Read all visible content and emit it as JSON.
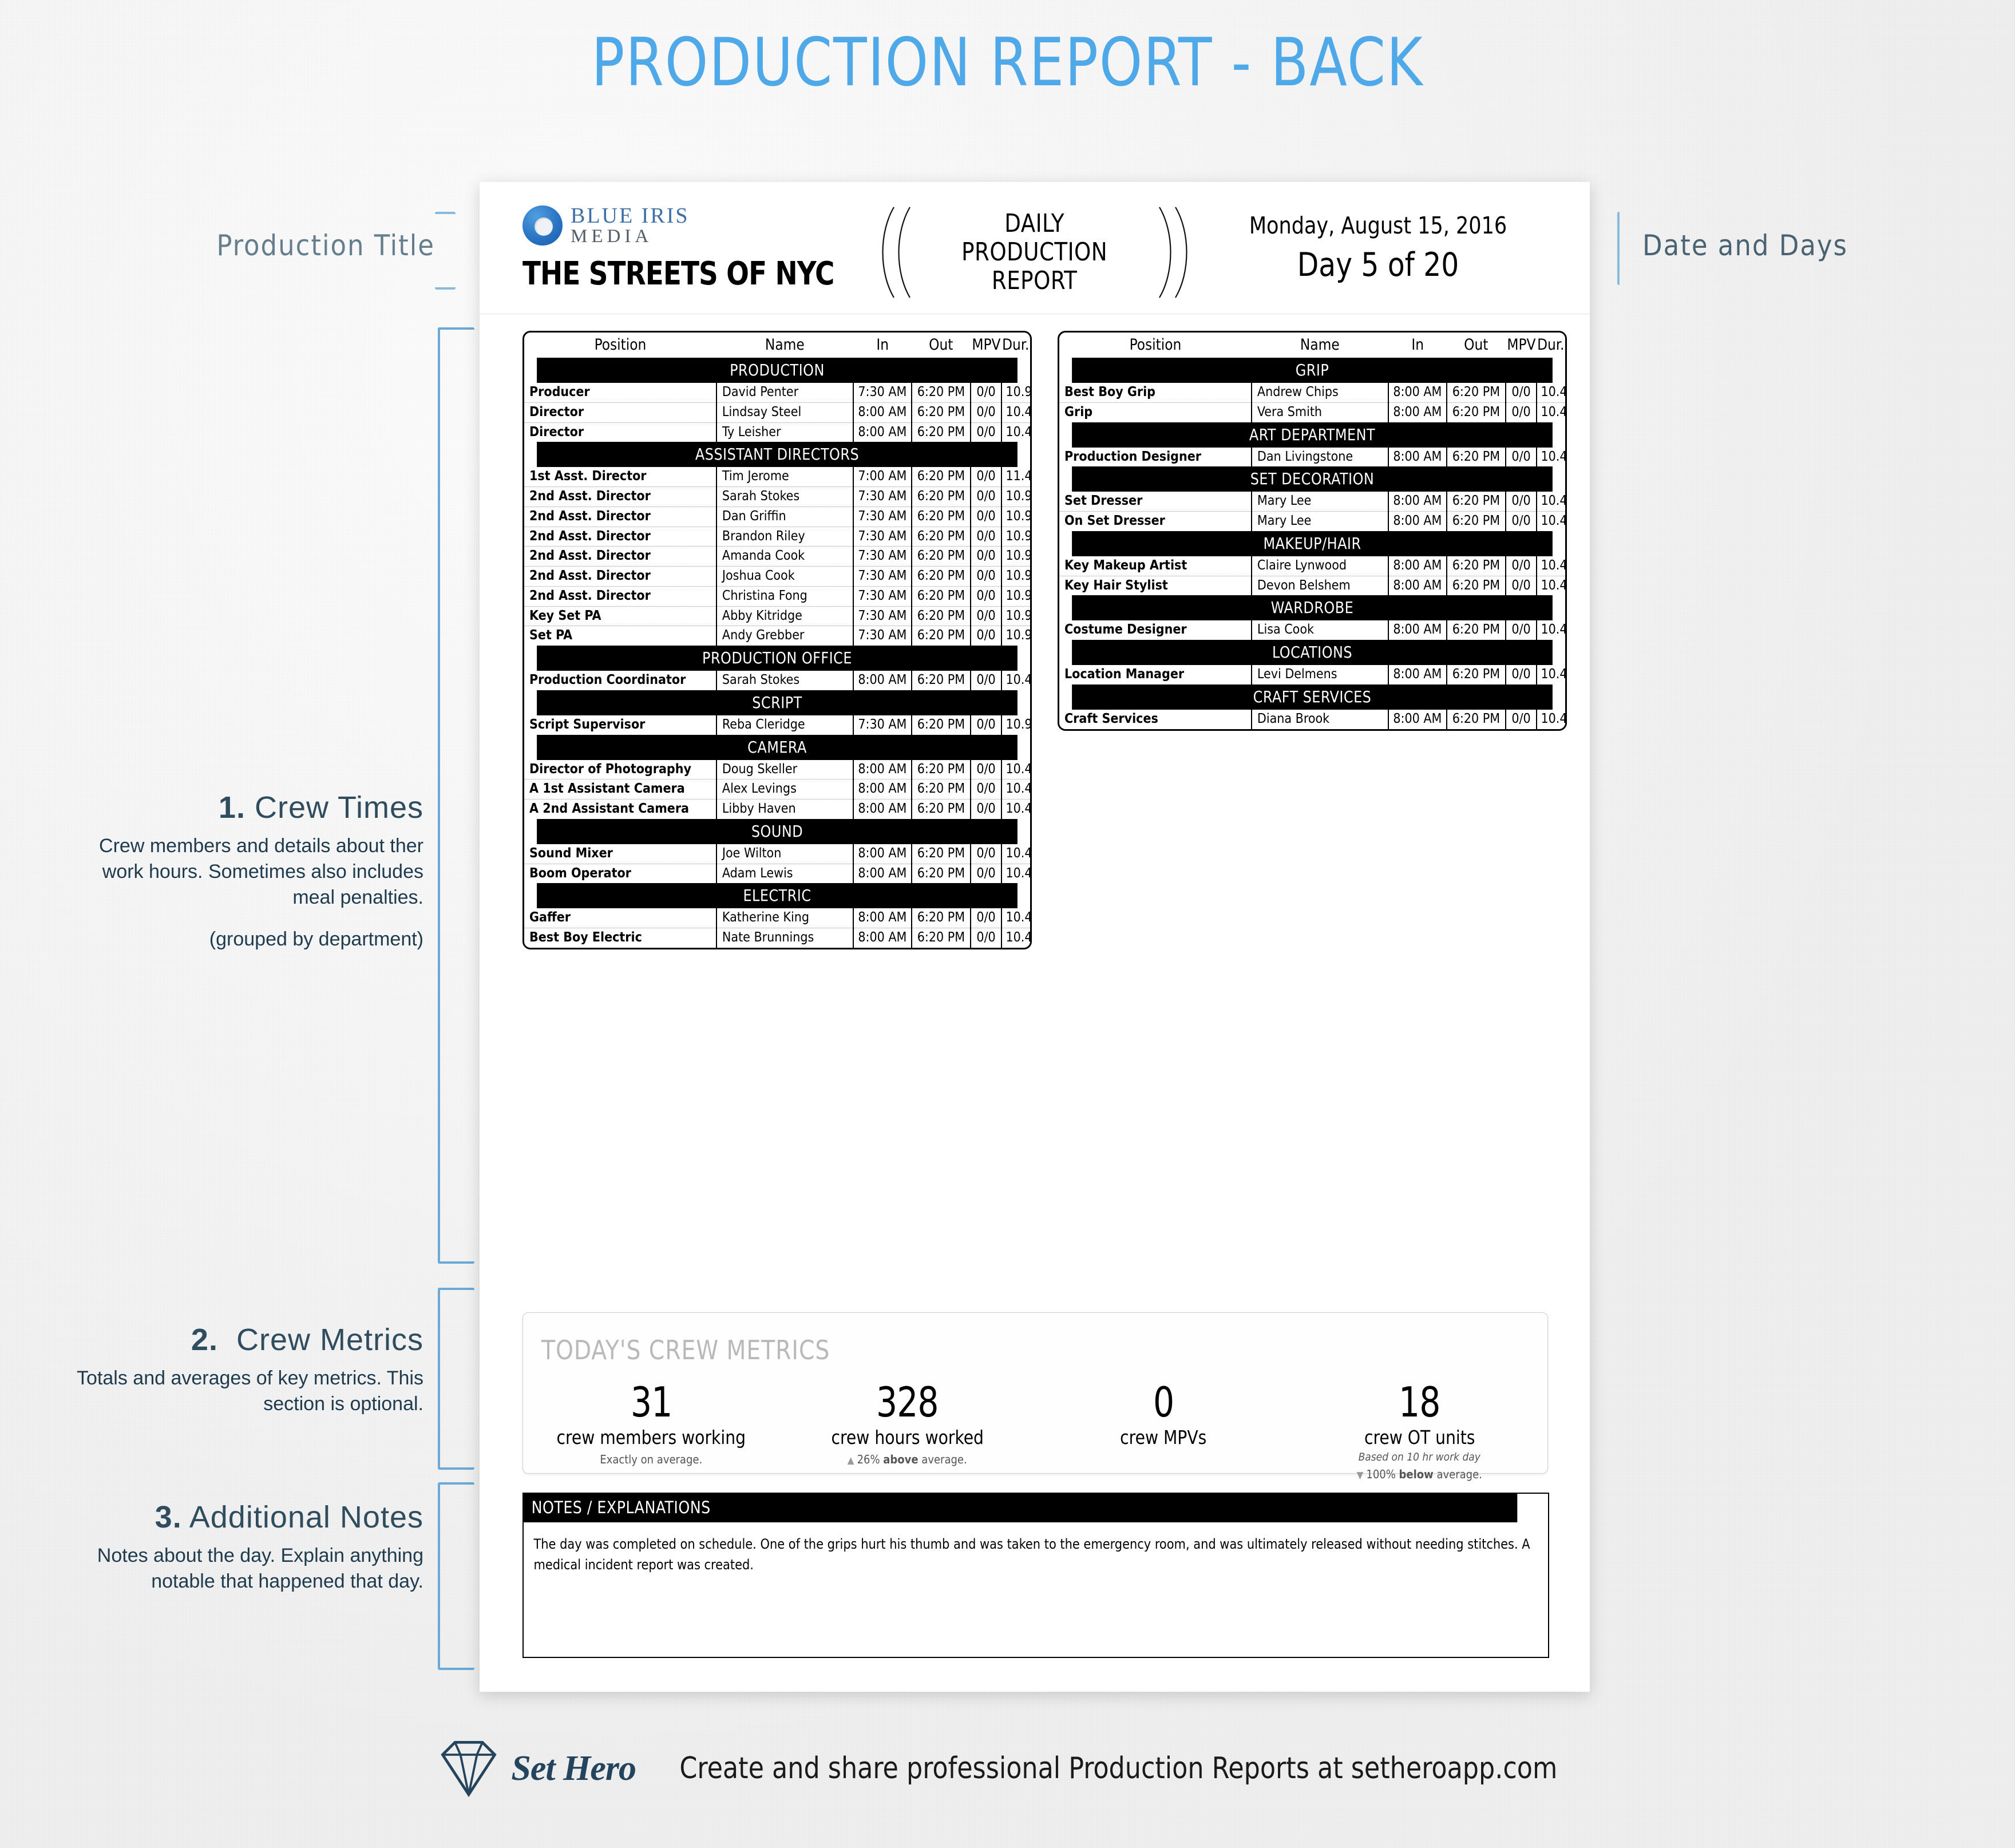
{
  "page": {
    "headline": "PRODUCTION REPORT - BACK",
    "accent_color": "#4FA9E8",
    "annotation_color": "#2f4d5e"
  },
  "annotations": {
    "production_title": "Production Title",
    "date_and_days": "Date and Days",
    "sections": [
      {
        "number": "1.",
        "title": "Crew Times",
        "body": "Crew members and details about ther work hours. Sometimes also includes meal penalties.",
        "note": "(grouped by department)"
      },
      {
        "number": "2.",
        "title": "Crew Metrics",
        "body": "Totals and averages of key metrics. This section is optional.",
        "note": ""
      },
      {
        "number": "3.",
        "title": "Additional Notes",
        "body": "Notes about the day.  Explain anything notable that happened that day.",
        "note": ""
      }
    ]
  },
  "document": {
    "logo": {
      "line1": "BLUE IRIS",
      "line2": "MEDIA"
    },
    "production_title": "THE STREETS OF NYC",
    "report_label": "DAILY\nPRODUCTION\nREPORT",
    "report_label_lines": [
      "DAILY",
      "PRODUCTION",
      "REPORT"
    ],
    "date": "Monday, August 15, 2016",
    "day_of": "Day 5 of 20"
  },
  "crew_table": {
    "columns": [
      "Position",
      "Name",
      "In",
      "Out",
      "MPV",
      "Dur."
    ],
    "left": [
      {
        "department": "PRODUCTION",
        "rows": [
          {
            "position": "Producer",
            "name": "David Penter",
            "in": "7:30 AM",
            "out": "6:20 PM",
            "mpv": "0/0",
            "dur": "10.9"
          },
          {
            "position": "Director",
            "name": "Lindsay Steel",
            "in": "8:00 AM",
            "out": "6:20 PM",
            "mpv": "0/0",
            "dur": "10.4"
          },
          {
            "position": "Director",
            "name": "Ty Leisher",
            "in": "8:00 AM",
            "out": "6:20 PM",
            "mpv": "0/0",
            "dur": "10.4"
          }
        ]
      },
      {
        "department": "ASSISTANT DIRECTORS",
        "rows": [
          {
            "position": "1st Asst. Director",
            "name": "Tim Jerome",
            "in": "7:00 AM",
            "out": "6:20 PM",
            "mpv": "0/0",
            "dur": "11.4"
          },
          {
            "position": "2nd Asst. Director",
            "name": "Sarah Stokes",
            "in": "7:30 AM",
            "out": "6:20 PM",
            "mpv": "0/0",
            "dur": "10.9"
          },
          {
            "position": "2nd Asst. Director",
            "name": "Dan Griffin",
            "in": "7:30 AM",
            "out": "6:20 PM",
            "mpv": "0/0",
            "dur": "10.9"
          },
          {
            "position": "2nd Asst. Director",
            "name": "Brandon Riley",
            "in": "7:30 AM",
            "out": "6:20 PM",
            "mpv": "0/0",
            "dur": "10.9"
          },
          {
            "position": "2nd Asst. Director",
            "name": "Amanda Cook",
            "in": "7:30 AM",
            "out": "6:20 PM",
            "mpv": "0/0",
            "dur": "10.9"
          },
          {
            "position": "2nd Asst. Director",
            "name": "Joshua Cook",
            "in": "7:30 AM",
            "out": "6:20 PM",
            "mpv": "0/0",
            "dur": "10.9"
          },
          {
            "position": "2nd Asst. Director",
            "name": "Christina Fong",
            "in": "7:30 AM",
            "out": "6:20 PM",
            "mpv": "0/0",
            "dur": "10.9"
          },
          {
            "position": "Key Set PA",
            "name": "Abby Kitridge",
            "in": "7:30 AM",
            "out": "6:20 PM",
            "mpv": "0/0",
            "dur": "10.9"
          },
          {
            "position": "Set PA",
            "name": "Andy Grebber",
            "in": "7:30 AM",
            "out": "6:20 PM",
            "mpv": "0/0",
            "dur": "10.9"
          }
        ]
      },
      {
        "department": "PRODUCTION OFFICE",
        "rows": [
          {
            "position": "Production Coordinator",
            "name": "Sarah Stokes",
            "in": "8:00 AM",
            "out": "6:20 PM",
            "mpv": "0/0",
            "dur": "10.4"
          }
        ]
      },
      {
        "department": "SCRIPT",
        "rows": [
          {
            "position": "Script Supervisor",
            "name": "Reba Cleridge",
            "in": "7:30 AM",
            "out": "6:20 PM",
            "mpv": "0/0",
            "dur": "10.9"
          }
        ]
      },
      {
        "department": "CAMERA",
        "rows": [
          {
            "position": "Director of Photography",
            "name": "Doug Skeller",
            "in": "8:00 AM",
            "out": "6:20 PM",
            "mpv": "0/0",
            "dur": "10.4"
          },
          {
            "position": "A 1st Assistant Camera",
            "name": "Alex Levings",
            "in": "8:00 AM",
            "out": "6:20 PM",
            "mpv": "0/0",
            "dur": "10.4"
          },
          {
            "position": "A 2nd Assistant Camera",
            "name": "Libby Haven",
            "in": "8:00 AM",
            "out": "6:20 PM",
            "mpv": "0/0",
            "dur": "10.4"
          }
        ]
      },
      {
        "department": "SOUND",
        "rows": [
          {
            "position": "Sound Mixer",
            "name": "Joe Wilton",
            "in": "8:00 AM",
            "out": "6:20 PM",
            "mpv": "0/0",
            "dur": "10.4"
          },
          {
            "position": "Boom Operator",
            "name": "Adam Lewis",
            "in": "8:00 AM",
            "out": "6:20 PM",
            "mpv": "0/0",
            "dur": "10.4"
          }
        ]
      },
      {
        "department": "ELECTRIC",
        "rows": [
          {
            "position": "Gaffer",
            "name": "Katherine King",
            "in": "8:00 AM",
            "out": "6:20 PM",
            "mpv": "0/0",
            "dur": "10.4"
          },
          {
            "position": "Best Boy Electric",
            "name": "Nate Brunnings",
            "in": "8:00 AM",
            "out": "6:20 PM",
            "mpv": "0/0",
            "dur": "10.4"
          }
        ]
      }
    ],
    "right": [
      {
        "department": "GRIP",
        "rows": [
          {
            "position": "Best Boy Grip",
            "name": "Andrew Chips",
            "in": "8:00 AM",
            "out": "6:20 PM",
            "mpv": "0/0",
            "dur": "10.4"
          },
          {
            "position": "Grip",
            "name": "Vera Smith",
            "in": "8:00 AM",
            "out": "6:20 PM",
            "mpv": "0/0",
            "dur": "10.4"
          }
        ]
      },
      {
        "department": "ART DEPARTMENT",
        "rows": [
          {
            "position": "Production Designer",
            "name": "Dan Livingstone",
            "in": "8:00 AM",
            "out": "6:20 PM",
            "mpv": "0/0",
            "dur": "10.4"
          }
        ]
      },
      {
        "department": "SET DECORATION",
        "rows": [
          {
            "position": "Set Dresser",
            "name": "Mary Lee",
            "in": "8:00 AM",
            "out": "6:20 PM",
            "mpv": "0/0",
            "dur": "10.4"
          },
          {
            "position": "On Set Dresser",
            "name": "Mary Lee",
            "in": "8:00 AM",
            "out": "6:20 PM",
            "mpv": "0/0",
            "dur": "10.4"
          }
        ]
      },
      {
        "department": "MAKEUP/HAIR",
        "rows": [
          {
            "position": "Key Makeup Artist",
            "name": "Claire Lynwood",
            "in": "8:00 AM",
            "out": "6:20 PM",
            "mpv": "0/0",
            "dur": "10.4"
          },
          {
            "position": "Key Hair Stylist",
            "name": "Devon Belshem",
            "in": "8:00 AM",
            "out": "6:20 PM",
            "mpv": "0/0",
            "dur": "10.4"
          }
        ]
      },
      {
        "department": "WARDROBE",
        "rows": [
          {
            "position": "Costume Designer",
            "name": "Lisa Cook",
            "in": "8:00 AM",
            "out": "6:20 PM",
            "mpv": "0/0",
            "dur": "10.4"
          }
        ]
      },
      {
        "department": "LOCATIONS",
        "rows": [
          {
            "position": "Location Manager",
            "name": "Levi Delmens",
            "in": "8:00 AM",
            "out": "6:20 PM",
            "mpv": "0/0",
            "dur": "10.4"
          }
        ]
      },
      {
        "department": "CRAFT SERVICES",
        "rows": [
          {
            "position": "Craft Services",
            "name": "Diana Brook",
            "in": "8:00 AM",
            "out": "6:20 PM",
            "mpv": "0/0",
            "dur": "10.4"
          }
        ]
      }
    ]
  },
  "metrics": {
    "title": "TODAY'S CREW METRICS",
    "cells": [
      {
        "value": "31",
        "label": "crew members working",
        "italic": "",
        "trend_icon": "",
        "trend": "Exactly on average."
      },
      {
        "value": "328",
        "label": "crew hours worked",
        "italic": "",
        "trend_icon": "up",
        "trend_pct": "26%",
        "trend_dir": "above",
        "trend_tail": "average."
      },
      {
        "value": "0",
        "label": "crew MPVs",
        "italic": "",
        "trend_icon": "",
        "trend": ""
      },
      {
        "value": "18",
        "label": "crew OT units",
        "italic": "Based on 10 hr work day",
        "trend_icon": "down",
        "trend_pct": "100%",
        "trend_dir": "below",
        "trend_tail": "average."
      }
    ]
  },
  "notes": {
    "header": "NOTES / EXPLANATIONS",
    "body": "The day was completed on schedule.  One of the grips hurt his thumb and was taken to the emergency room, and was ultimately released without needing stitches.  A medical incident report was created."
  },
  "footer": {
    "brand": "Set Hero",
    "text": "Create and share professional Production Reports at setheroapp.com"
  }
}
